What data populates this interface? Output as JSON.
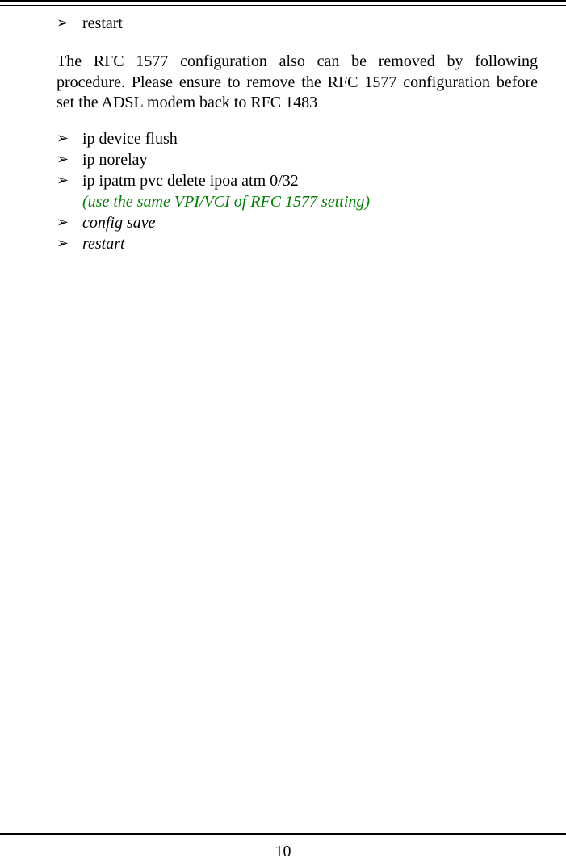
{
  "bullets_top": [
    {
      "text": "restart",
      "italic": false
    }
  ],
  "paragraph": "The RFC 1577 configuration also can be removed by following procedure. Please ensure to remove the RFC 1577 configuration before set the ADSL modem back to RFC 1483",
  "bullets_bottom": [
    {
      "text": "ip device flush",
      "italic": false
    },
    {
      "text": "ip norelay",
      "italic": false
    },
    {
      "text": "ip ipatm pvc delete ipoa atm 0/32",
      "italic": false
    }
  ],
  "note": "(use the same VPI/VCI of RFC 1577 setting)",
  "bullets_after": [
    {
      "text": "config save",
      "italic": true
    },
    {
      "text": "restart",
      "italic": true
    }
  ],
  "page_number": "10"
}
